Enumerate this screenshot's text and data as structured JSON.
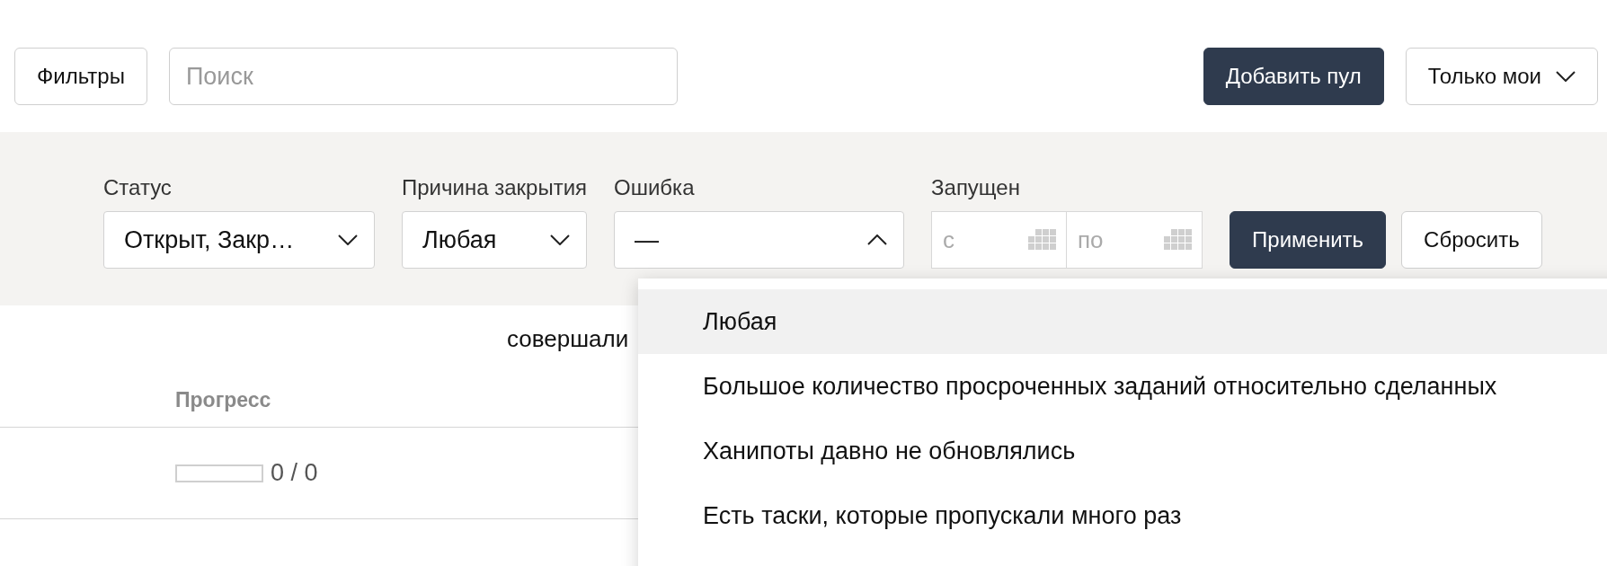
{
  "toolbar": {
    "filters_button": "Фильтры",
    "search": {
      "placeholder": "Поиск"
    },
    "add_button": "Добавить пул",
    "owner_select": {
      "value": "Только мои",
      "expanded": false
    }
  },
  "filters": {
    "fields": [
      {
        "kind": "select",
        "label": "Статус",
        "value": "Открыт, Закр…",
        "expanded": false
      },
      {
        "kind": "select",
        "label": "Причина закрытия",
        "value": "Любая",
        "expanded": false
      },
      {
        "kind": "select",
        "label": "Ошибка",
        "value": "—",
        "expanded": true
      },
      {
        "kind": "date_range",
        "label": "Запущен",
        "from_placeholder": "с",
        "to_placeholder": "по"
      }
    ],
    "apply_button": "Применить",
    "reset_button": "Сбросить"
  },
  "content": {
    "text": "совершали",
    "table": {
      "columns": [
        "Прогресс"
      ],
      "rows": [
        {
          "progress": {
            "level": 0,
            "reading": "0 / 0"
          }
        }
      ]
    }
  },
  "dropdown": {
    "options": [
      {
        "label": "Любая",
        "selected": true
      },
      {
        "label": "Большое количество просроченных заданий относительно сделанных",
        "selected": false
      },
      {
        "label": "Ханипоты давно не обновлялись",
        "selected": false
      },
      {
        "label": "Есть таски, которые пропускали много раз",
        "selected": false
      }
    ]
  }
}
